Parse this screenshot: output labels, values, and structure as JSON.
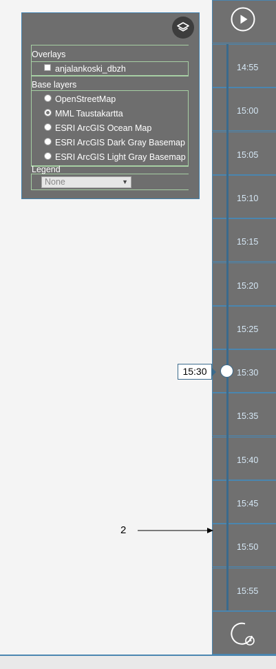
{
  "layers": {
    "overlays_title": "Overlays",
    "overlays": [
      {
        "label": "anjalankoski_dbzh",
        "checked": false
      }
    ],
    "base_title": "Base layers",
    "base_layers": [
      {
        "label": "OpenStreetMap",
        "checked": false
      },
      {
        "label": "MML Taustakartta",
        "checked": true
      },
      {
        "label": "ESRI ArcGIS Ocean Map",
        "checked": false
      },
      {
        "label": "ESRI ArcGIS Dark Gray Basemap",
        "checked": false
      },
      {
        "label": "ESRI ArcGIS Light Gray Basemap",
        "checked": false
      }
    ],
    "legend_title": "Legend",
    "legend_selected": "None"
  },
  "timeline": {
    "ticks": [
      "14:55",
      "15:00",
      "15:05",
      "15:10",
      "15:15",
      "15:20",
      "15:25",
      "15:30",
      "15:35",
      "15:40",
      "15:45",
      "15:50",
      "15:55"
    ],
    "current_time": "15:30"
  },
  "annotation": {
    "number": "2"
  }
}
